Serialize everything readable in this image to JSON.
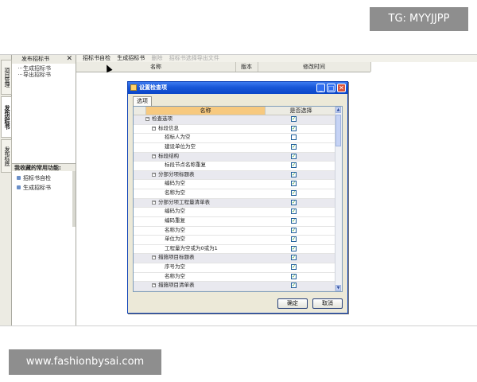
{
  "watermark_top": "TG: MYYJJPP",
  "watermark_bottom": "www.fashionbysai.com",
  "left_tabs": [
    "项目管理",
    "发布招标书",
    "发布标底"
  ],
  "left_panel": {
    "title": "发布招标书",
    "close": "✕",
    "tree": [
      "生成招标书",
      "导出招标书"
    ],
    "favorites_title": "我收藏的常用功能:",
    "favorites": [
      "招标书自检",
      "生成招标书"
    ]
  },
  "toolbar": {
    "items": [
      "招标书自检",
      "生成招标书"
    ],
    "dim_items": [
      "删除",
      "招标书选择导出文件"
    ]
  },
  "grid_columns": [
    "名称",
    "版本",
    "修改时间"
  ],
  "dialog": {
    "title": "设置检查项",
    "tab": "选项",
    "col_name": "名称",
    "col_check": "是否选择",
    "rows": [
      {
        "label": "检查选项",
        "level": 0,
        "group": true,
        "toggle": "−",
        "checked": true
      },
      {
        "label": "标段信息",
        "level": 1,
        "group": false,
        "toggle": "−",
        "checked": true
      },
      {
        "label": "招标人为空",
        "level": 2,
        "group": false,
        "toggle": "",
        "checked": false
      },
      {
        "label": "建设单位为空",
        "level": 2,
        "group": false,
        "toggle": "",
        "checked": true
      },
      {
        "label": "标段结构",
        "level": 1,
        "group": true,
        "toggle": "−",
        "checked": true
      },
      {
        "label": "标段节点名称重复",
        "level": 2,
        "group": false,
        "toggle": "",
        "checked": true
      },
      {
        "label": "分部分项标题表",
        "level": 1,
        "group": true,
        "toggle": "−",
        "checked": true
      },
      {
        "label": "编码为空",
        "level": 2,
        "group": false,
        "toggle": "",
        "checked": true
      },
      {
        "label": "名称为空",
        "level": 2,
        "group": false,
        "toggle": "",
        "checked": true
      },
      {
        "label": "分部分项工程量清单表",
        "level": 1,
        "group": true,
        "toggle": "−",
        "checked": true
      },
      {
        "label": "编码为空",
        "level": 2,
        "group": false,
        "toggle": "",
        "checked": true
      },
      {
        "label": "编码重复",
        "level": 2,
        "group": false,
        "toggle": "",
        "checked": true
      },
      {
        "label": "名称为空",
        "level": 2,
        "group": false,
        "toggle": "",
        "checked": true
      },
      {
        "label": "单位为空",
        "level": 2,
        "group": false,
        "toggle": "",
        "checked": true
      },
      {
        "label": "工程量为空或为0或为1",
        "level": 2,
        "group": false,
        "toggle": "",
        "checked": true
      },
      {
        "label": "措施项目标题表",
        "level": 1,
        "group": true,
        "toggle": "−",
        "checked": true
      },
      {
        "label": "序号为空",
        "level": 2,
        "group": false,
        "toggle": "",
        "checked": true
      },
      {
        "label": "名称为空",
        "level": 2,
        "group": false,
        "toggle": "",
        "checked": true
      },
      {
        "label": "措施项目清单表",
        "level": 1,
        "group": true,
        "toggle": "−",
        "checked": true
      }
    ],
    "ok": "确定",
    "cancel": "取消",
    "check_glyph": "✓",
    "minimize": "_",
    "maximize": "□",
    "close": "✕"
  },
  "colors": {
    "titlebar": "#1857d8",
    "accent_check": "#1d8f1d",
    "header_orange": "#f7c97f"
  }
}
